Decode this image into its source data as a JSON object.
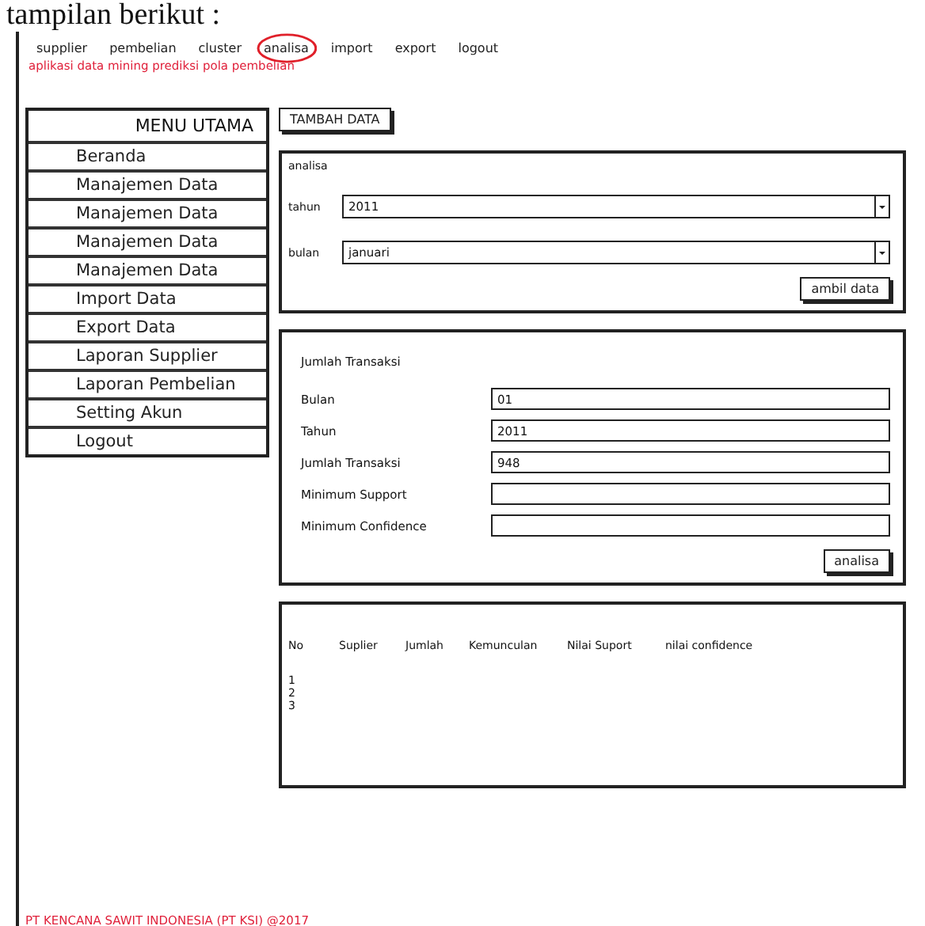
{
  "caption": "tampilan berikut :",
  "nav": [
    {
      "label": "supplier",
      "circled": false
    },
    {
      "label": "pembelian",
      "circled": false
    },
    {
      "label": "cluster",
      "circled": false
    },
    {
      "label": "analisa",
      "circled": true
    },
    {
      "label": "import",
      "circled": false
    },
    {
      "label": "export",
      "circled": false
    },
    {
      "label": "logout",
      "circled": false
    }
  ],
  "subtitle": "aplikasi data mining prediksi pola pembelian",
  "sidebar": {
    "title": "MENU UTAMA",
    "items": [
      "Beranda",
      "Manajemen Data",
      "Manajemen Data",
      "Manajemen Data",
      "Manajemen Data",
      "Import Data",
      "Export Data",
      "Laporan Supplier",
      "Laporan Pembelian",
      "Setting Akun",
      "Logout"
    ]
  },
  "add_button": "TAMBAH DATA",
  "filter": {
    "title": "analisa",
    "fields": [
      {
        "label": "tahun",
        "value": "2011"
      },
      {
        "label": "bulan",
        "value": "januari"
      }
    ],
    "button": "ambil data"
  },
  "form": {
    "title": "Jumlah Transaksi",
    "fields": [
      {
        "label": "Bulan",
        "value": "01"
      },
      {
        "label": "Tahun",
        "value": "2011"
      },
      {
        "label": "Jumlah Transaksi",
        "value": "948"
      },
      {
        "label": "Minimum Support"
      },
      {
        "label": "Minimum Confidence"
      }
    ],
    "button": "analisa"
  },
  "table": {
    "columns": [
      "No",
      "Suplier",
      "Jumlah",
      "Kemunculan",
      "Nilai Suport",
      "nilai confidence"
    ],
    "rows": [
      "1",
      "2",
      "3"
    ]
  },
  "footer": "PT KENCANA SAWIT INDONESIA (PT KSI) @2017"
}
